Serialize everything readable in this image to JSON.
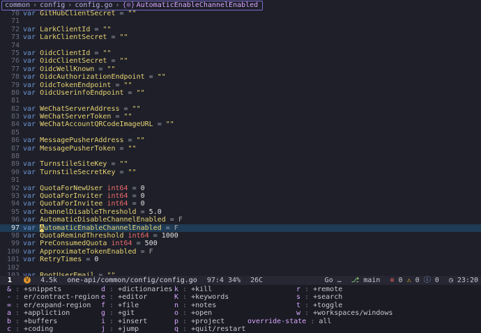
{
  "breadcrumb": {
    "items": [
      "common",
      "config",
      "config.go"
    ],
    "symbol_icon": "{⊙}",
    "current": "AutomaticEnableChannelEnabled"
  },
  "editor": {
    "lines": [
      {
        "n": "70",
        "kw": "var",
        "id": "GitHubClientSecret",
        "type": "",
        "eq": "=",
        "val": "\"\"",
        "vt": "str"
      },
      {
        "n": "71",
        "kw": "",
        "id": "",
        "type": "",
        "eq": "",
        "val": "",
        "vt": ""
      },
      {
        "n": "72",
        "kw": "var",
        "id": "LarkClientId",
        "type": "",
        "eq": "=",
        "val": "\"\"",
        "vt": "str"
      },
      {
        "n": "73",
        "kw": "var",
        "id": "LarkClientSecret",
        "type": "",
        "eq": "=",
        "val": "\"\"",
        "vt": "str"
      },
      {
        "n": "74",
        "kw": "",
        "id": "",
        "type": "",
        "eq": "",
        "val": "",
        "vt": ""
      },
      {
        "n": "75",
        "kw": "var",
        "id": "OidcClientId",
        "type": "",
        "eq": "=",
        "val": "\"\"",
        "vt": "str"
      },
      {
        "n": "76",
        "kw": "var",
        "id": "OidcClientSecret",
        "type": "",
        "eq": "=",
        "val": "\"\"",
        "vt": "str"
      },
      {
        "n": "77",
        "kw": "var",
        "id": "OidcWellKnown",
        "type": "",
        "eq": "=",
        "val": "\"\"",
        "vt": "str"
      },
      {
        "n": "78",
        "kw": "var",
        "id": "OidcAuthorizationEndpoint",
        "type": "",
        "eq": "=",
        "val": "\"\"",
        "vt": "str"
      },
      {
        "n": "79",
        "kw": "var",
        "id": "OidcTokenEndpoint",
        "type": "",
        "eq": "=",
        "val": "\"\"",
        "vt": "str"
      },
      {
        "n": "80",
        "kw": "var",
        "id": "OidcUserinfoEndpoint",
        "type": "",
        "eq": "=",
        "val": "\"\"",
        "vt": "str"
      },
      {
        "n": "81",
        "kw": "",
        "id": "",
        "type": "",
        "eq": "",
        "val": "",
        "vt": ""
      },
      {
        "n": "82",
        "kw": "var",
        "id": "WeChatServerAddress",
        "type": "",
        "eq": "=",
        "val": "\"\"",
        "vt": "str"
      },
      {
        "n": "83",
        "kw": "var",
        "id": "WeChatServerToken",
        "type": "",
        "eq": "=",
        "val": "\"\"",
        "vt": "str"
      },
      {
        "n": "84",
        "kw": "var",
        "id": "WeChatAccountQRCodeImageURL",
        "type": "",
        "eq": "=",
        "val": "\"\"",
        "vt": "str"
      },
      {
        "n": "85",
        "kw": "",
        "id": "",
        "type": "",
        "eq": "",
        "val": "",
        "vt": ""
      },
      {
        "n": "86",
        "kw": "var",
        "id": "MessagePusherAddress",
        "type": "",
        "eq": "=",
        "val": "\"\"",
        "vt": "str"
      },
      {
        "n": "87",
        "kw": "var",
        "id": "MessagePusherToken",
        "type": "",
        "eq": "=",
        "val": "\"\"",
        "vt": "str"
      },
      {
        "n": "88",
        "kw": "",
        "id": "",
        "type": "",
        "eq": "",
        "val": "",
        "vt": ""
      },
      {
        "n": "89",
        "kw": "var",
        "id": "TurnstileSiteKey",
        "type": "",
        "eq": "=",
        "val": "\"\"",
        "vt": "str"
      },
      {
        "n": "90",
        "kw": "var",
        "id": "TurnstileSecretKey",
        "type": "",
        "eq": "=",
        "val": "\"\"",
        "vt": "str"
      },
      {
        "n": "91",
        "kw": "",
        "id": "",
        "type": "",
        "eq": "",
        "val": "",
        "vt": ""
      },
      {
        "n": "92",
        "kw": "var",
        "id": "QuotaForNewUser",
        "type": "int64",
        "eq": "=",
        "val": "0",
        "vt": "num"
      },
      {
        "n": "93",
        "kw": "var",
        "id": "QuotaForInviter",
        "type": "int64",
        "eq": "=",
        "val": "0",
        "vt": "num"
      },
      {
        "n": "94",
        "kw": "var",
        "id": "QuotaForInvitee",
        "type": "int64",
        "eq": "=",
        "val": "0",
        "vt": "num"
      },
      {
        "n": "95",
        "kw": "var",
        "id": "ChannelDisableThreshold",
        "type": "",
        "eq": "=",
        "val": "5.0",
        "vt": "num"
      },
      {
        "n": "96",
        "kw": "var",
        "id": "AutomaticDisableChannelEnabled",
        "type": "",
        "eq": "=",
        "val": "F",
        "vt": "bool"
      },
      {
        "n": "97",
        "kw": "var",
        "id": "AutomaticEnableChannelEnabled",
        "type": "",
        "eq": "=",
        "val": "F",
        "vt": "bool",
        "current": true
      },
      {
        "n": "98",
        "kw": "var",
        "id": "QuotaRemindThreshold",
        "type": "int64",
        "eq": "=",
        "val": "1000",
        "vt": "num"
      },
      {
        "n": "99",
        "kw": "var",
        "id": "PreConsumedQuota",
        "type": "int64",
        "eq": "=",
        "val": "500",
        "vt": "num"
      },
      {
        "n": "100",
        "kw": "var",
        "id": "ApproximateTokenEnabled",
        "type": "",
        "eq": "=",
        "val": "F",
        "vt": "bool"
      },
      {
        "n": "101",
        "kw": "var",
        "id": "RetryTimes",
        "type": "",
        "eq": "=",
        "val": "0",
        "vt": "num"
      },
      {
        "n": "102",
        "kw": "",
        "id": "",
        "type": "",
        "eq": "",
        "val": "",
        "vt": ""
      },
      {
        "n": "103",
        "kw": "var",
        "id": "RootUserEmail",
        "type": "",
        "eq": "=",
        "val": "\"\"",
        "vt": "str"
      }
    ]
  },
  "statusbar": {
    "window_number": "1",
    "badge": "V",
    "file_size": "4.5k",
    "file_path": "one-api/common/config/config.go",
    "position": "97:4",
    "percent": "34%",
    "column": "26C",
    "language": "Go …",
    "branch": "main",
    "errors": "0",
    "warnings": "0",
    "infos": "0",
    "clock": "23:20"
  },
  "whichkey": {
    "columns": [
      [
        {
          "key": "&",
          "desc": "+snippets"
        },
        {
          "key": "-",
          "desc": "er/contract-region"
        },
        {
          "key": "=",
          "desc": "er/expand-region"
        },
        {
          "key": "a",
          "desc": "+appliction"
        },
        {
          "key": "b",
          "desc": "+buffers"
        },
        {
          "key": "c",
          "desc": "+coding"
        }
      ],
      [
        {
          "key": "d",
          "desc": "+dictionaries"
        },
        {
          "key": "e",
          "desc": "+editor"
        },
        {
          "key": "f",
          "desc": "+file"
        },
        {
          "key": "g",
          "desc": "+git"
        },
        {
          "key": "i",
          "desc": "+insert"
        },
        {
          "key": "j",
          "desc": "+jump"
        }
      ],
      [
        {
          "key": "k",
          "desc": "+kill"
        },
        {
          "key": "K",
          "desc": "+keywords"
        },
        {
          "key": "n",
          "desc": "+notes"
        },
        {
          "key": "o",
          "desc": "+open"
        },
        {
          "key": "p",
          "desc": "+project"
        },
        {
          "key": "q",
          "desc": "+quit/restart"
        }
      ],
      [
        {
          "key": "",
          "desc": ""
        },
        {
          "key": "",
          "desc": ""
        },
        {
          "key": "",
          "desc": ""
        },
        {
          "key": "",
          "desc": ""
        },
        {
          "key": "override-state",
          "desc": "all"
        },
        {
          "key": "",
          "desc": ""
        }
      ],
      [
        {
          "key": "r",
          "desc": "+remote"
        },
        {
          "key": "s",
          "desc": "+search"
        },
        {
          "key": "t",
          "desc": "+toggle"
        },
        {
          "key": "w",
          "desc": "+workspaces/windows"
        },
        {
          "key": "",
          "desc": ""
        },
        {
          "key": "",
          "desc": ""
        }
      ]
    ]
  }
}
